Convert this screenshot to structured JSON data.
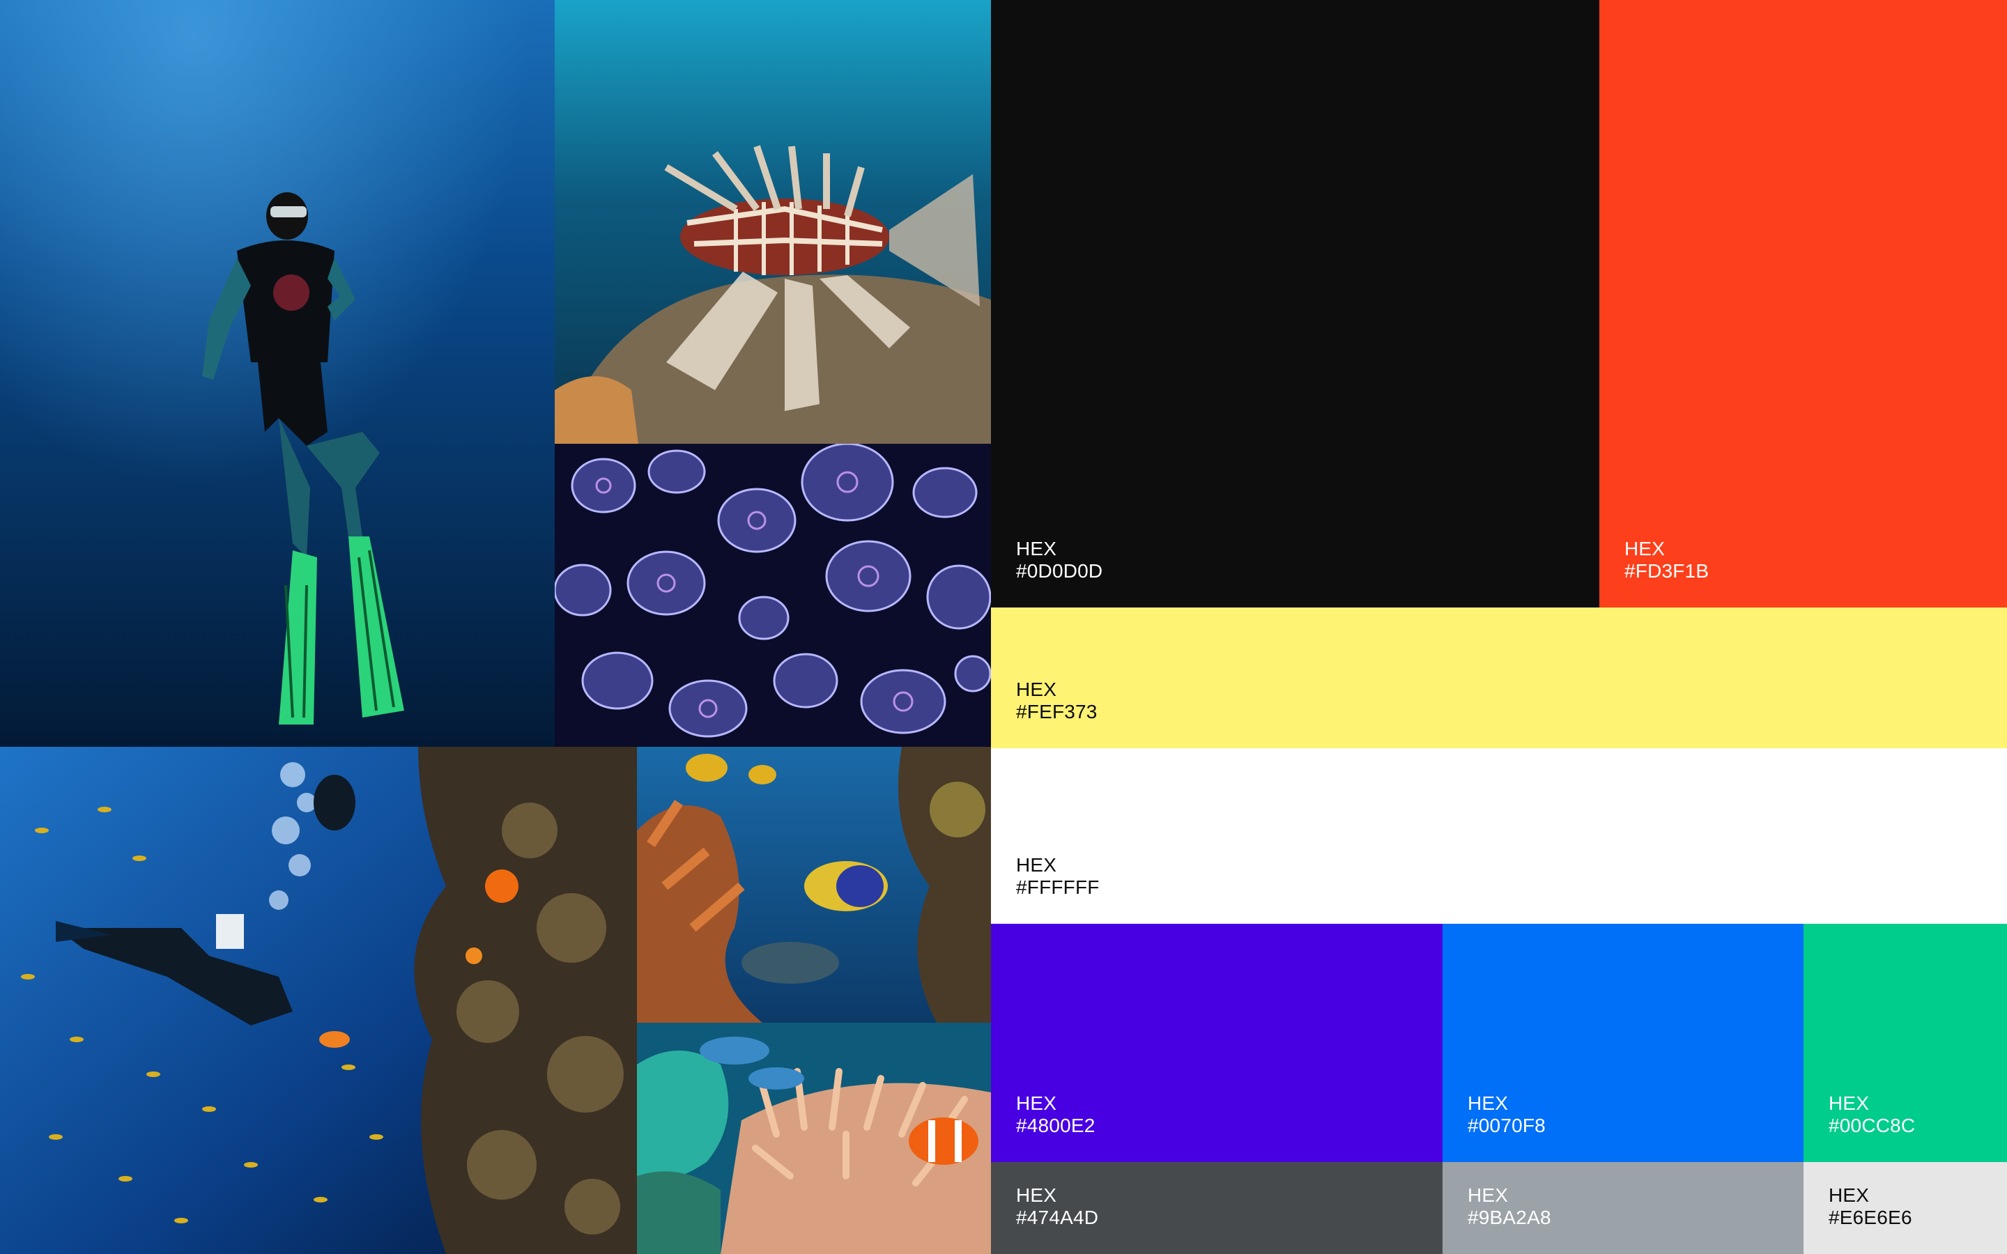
{
  "swatches": [
    {
      "label": "HEX",
      "value": "#0D0D0D",
      "color": "#0D0D0D",
      "text": "light"
    },
    {
      "label": "HEX",
      "value": "#FD3F1B",
      "color": "#FD3F1B",
      "text": "light"
    },
    {
      "label": "HEX",
      "value": "#FEF373",
      "color": "#FEF373",
      "text": "dark"
    },
    {
      "label": "HEX",
      "value": "#FFFFFF",
      "color": "#FFFFFF",
      "text": "dark"
    },
    {
      "label": "HEX",
      "value": "#4800E2",
      "color": "#4800E2",
      "text": "light"
    },
    {
      "label": "HEX",
      "value": "#0070F8",
      "color": "#0070F8",
      "text": "light"
    },
    {
      "label": "HEX",
      "value": "#00CC8C",
      "color": "#00CC8C",
      "text": "light"
    },
    {
      "label": "HEX",
      "value": "#474A4D",
      "color": "#474A4D",
      "text": "light"
    },
    {
      "label": "HEX",
      "value": "#9BA2A8",
      "color": "#9BA2A8",
      "text": "light"
    },
    {
      "label": "HEX",
      "value": "#E6E6E6",
      "color": "#E6E6E6",
      "text": "dark"
    }
  ],
  "photos": [
    {
      "name": "scuba-diver-photo"
    },
    {
      "name": "lionfish-photo"
    },
    {
      "name": "jellyfish-photo"
    },
    {
      "name": "diver-reef-photo"
    },
    {
      "name": "tropical-fish-photo"
    },
    {
      "name": "clownfish-anemone-photo"
    }
  ]
}
